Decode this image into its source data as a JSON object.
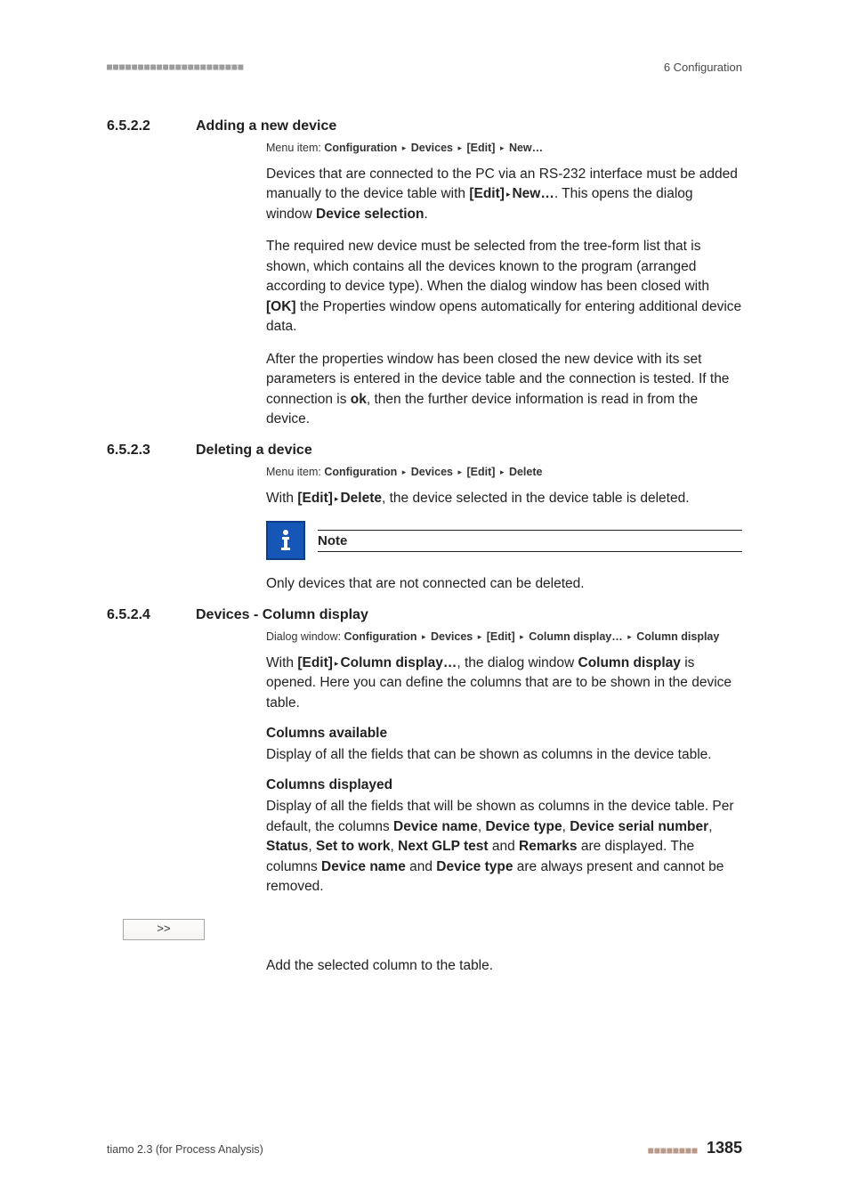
{
  "header": {
    "chapter": "6 Configuration"
  },
  "sections": [
    {
      "num": "6.5.2.2",
      "title": "Adding a new device",
      "menu": {
        "prefix": "Menu item: ",
        "parts": [
          "Configuration",
          "Devices",
          "[Edit]",
          "New…"
        ]
      },
      "paras": [
        {
          "runs": [
            {
              "t": "Devices that are connected to the PC via an RS-232 interface must be added manually to the device table with "
            },
            {
              "t": "[Edit]",
              "b": true
            },
            {
              "t": " ▸ ",
              "tri": true
            },
            {
              "t": "New…",
              "b": true
            },
            {
              "t": ". This opens the dialog window "
            },
            {
              "t": "Device selection",
              "b": true
            },
            {
              "t": "."
            }
          ]
        },
        {
          "runs": [
            {
              "t": "The required new device must be selected from the tree-form list that is shown, which contains all the devices known to the program (arranged according to device type). When the dialog window has been closed with "
            },
            {
              "t": "[OK]",
              "b": true
            },
            {
              "t": " the Properties window opens automatically for entering additional device data."
            }
          ]
        },
        {
          "runs": [
            {
              "t": "After the properties window has been closed the new device with its set parameters is entered in the device table and the connection is tested. If the connection is "
            },
            {
              "t": "ok",
              "b": true
            },
            {
              "t": ", then the further device information is read in from the device."
            }
          ]
        }
      ]
    },
    {
      "num": "6.5.2.3",
      "title": "Deleting a device",
      "menu": {
        "prefix": "Menu item: ",
        "parts": [
          "Configuration",
          "Devices",
          "[Edit]",
          "Delete"
        ]
      },
      "paras": [
        {
          "runs": [
            {
              "t": "With "
            },
            {
              "t": "[Edit]",
              "b": true
            },
            {
              "t": " ▸ ",
              "tri": true
            },
            {
              "t": "Delete",
              "b": true
            },
            {
              "t": ", the device selected in the device table is deleted."
            }
          ]
        }
      ],
      "note": {
        "title": "Note",
        "body": "Only devices that are not connected can be deleted."
      }
    },
    {
      "num": "6.5.2.4",
      "title": "Devices - Column display",
      "menu": {
        "prefix": "Dialog window: ",
        "parts": [
          "Configuration",
          "Devices",
          "[Edit]",
          "Column display…",
          "Column display"
        ]
      },
      "paras": [
        {
          "runs": [
            {
              "t": "With "
            },
            {
              "t": "[Edit]",
              "b": true
            },
            {
              "t": " ▸ ",
              "tri": true
            },
            {
              "t": "Column display…",
              "b": true
            },
            {
              "t": ", the dialog window "
            },
            {
              "t": "Column display",
              "b": true
            },
            {
              "t": " is opened. Here you can define the columns that are to be shown in the device table."
            }
          ]
        }
      ],
      "subsections": [
        {
          "head": "Columns available",
          "body": [
            {
              "runs": [
                {
                  "t": "Display of all the fields that can be shown as columns in the device table."
                }
              ]
            }
          ]
        },
        {
          "head": "Columns displayed",
          "body": [
            {
              "runs": [
                {
                  "t": "Display of all the fields that will be shown as columns in the device table. Per default, the columns "
                },
                {
                  "t": "Device name",
                  "b": true
                },
                {
                  "t": ", "
                },
                {
                  "t": "Device type",
                  "b": true
                },
                {
                  "t": ", "
                },
                {
                  "t": "Device serial number",
                  "b": true
                },
                {
                  "t": ", "
                },
                {
                  "t": "Status",
                  "b": true
                },
                {
                  "t": ", "
                },
                {
                  "t": "Set to work",
                  "b": true
                },
                {
                  "t": ", "
                },
                {
                  "t": "Next GLP test",
                  "b": true
                },
                {
                  "t": " and "
                },
                {
                  "t": "Remarks",
                  "b": true
                },
                {
                  "t": " are displayed. The columns "
                },
                {
                  "t": "Device name",
                  "b": true
                },
                {
                  "t": " and "
                },
                {
                  "t": "Device type",
                  "b": true
                },
                {
                  "t": " are always present and cannot be removed."
                }
              ]
            }
          ]
        }
      ],
      "button": {
        "label": ">>",
        "caption": "Add the selected column to the table."
      }
    }
  ],
  "footer": {
    "product": "tiamo 2.3 (for Process Analysis)",
    "page": "1385"
  }
}
